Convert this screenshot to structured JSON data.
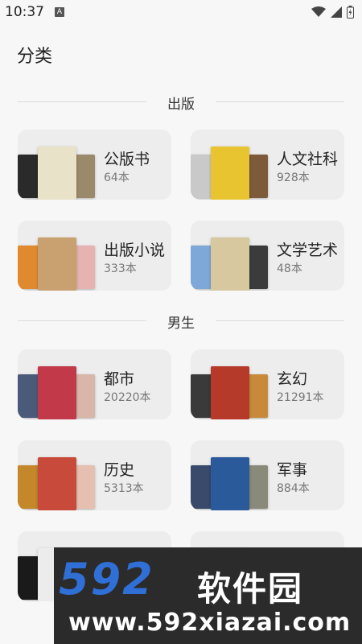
{
  "status": {
    "time": "10:37",
    "notif_icon": "A"
  },
  "page": {
    "title": "分类"
  },
  "sections": [
    {
      "label": "出版"
    },
    {
      "label": "男生"
    }
  ],
  "cards": [
    {
      "name": "公版书",
      "count": "64本",
      "colors": [
        "#2a2a2a",
        "#9a8a6a",
        "#e7e2c8"
      ]
    },
    {
      "name": "人文社科",
      "count": "928本",
      "colors": [
        "#c9c9c9",
        "#7d5a3a",
        "#e9c431"
      ]
    },
    {
      "name": "出版小说",
      "count": "333本",
      "colors": [
        "#e08a30",
        "#e5b3b0",
        "#c9a070"
      ]
    },
    {
      "name": "文学艺术",
      "count": "48本",
      "colors": [
        "#7da8d8",
        "#3b3b3b",
        "#d8c8a0"
      ]
    },
    {
      "name": "都市",
      "count": "20220本",
      "colors": [
        "#4c5a7a",
        "#d9b7a8",
        "#c23a4a"
      ]
    },
    {
      "name": "玄幻",
      "count": "21291本",
      "colors": [
        "#3a3a3a",
        "#c88a3a",
        "#b53a2a"
      ]
    },
    {
      "name": "历史",
      "count": "5313本",
      "colors": [
        "#c4872a",
        "#e5c0b0",
        "#c84a3a"
      ]
    },
    {
      "name": "军事",
      "count": "884本",
      "colors": [
        "#3a4a6a",
        "#8a8a7a",
        "#2a5a9a"
      ]
    },
    {
      "name": "",
      "count": "",
      "colors": [
        "#1a1a1a",
        "#2a2a2a",
        "#ececec"
      ]
    },
    {
      "name": "",
      "count": "",
      "colors": [
        "#ececec",
        "#ececec",
        "#ececec"
      ]
    }
  ],
  "watermark": {
    "logo": "592",
    "cn": "软件园",
    "url": "www.592xiazai.com"
  }
}
